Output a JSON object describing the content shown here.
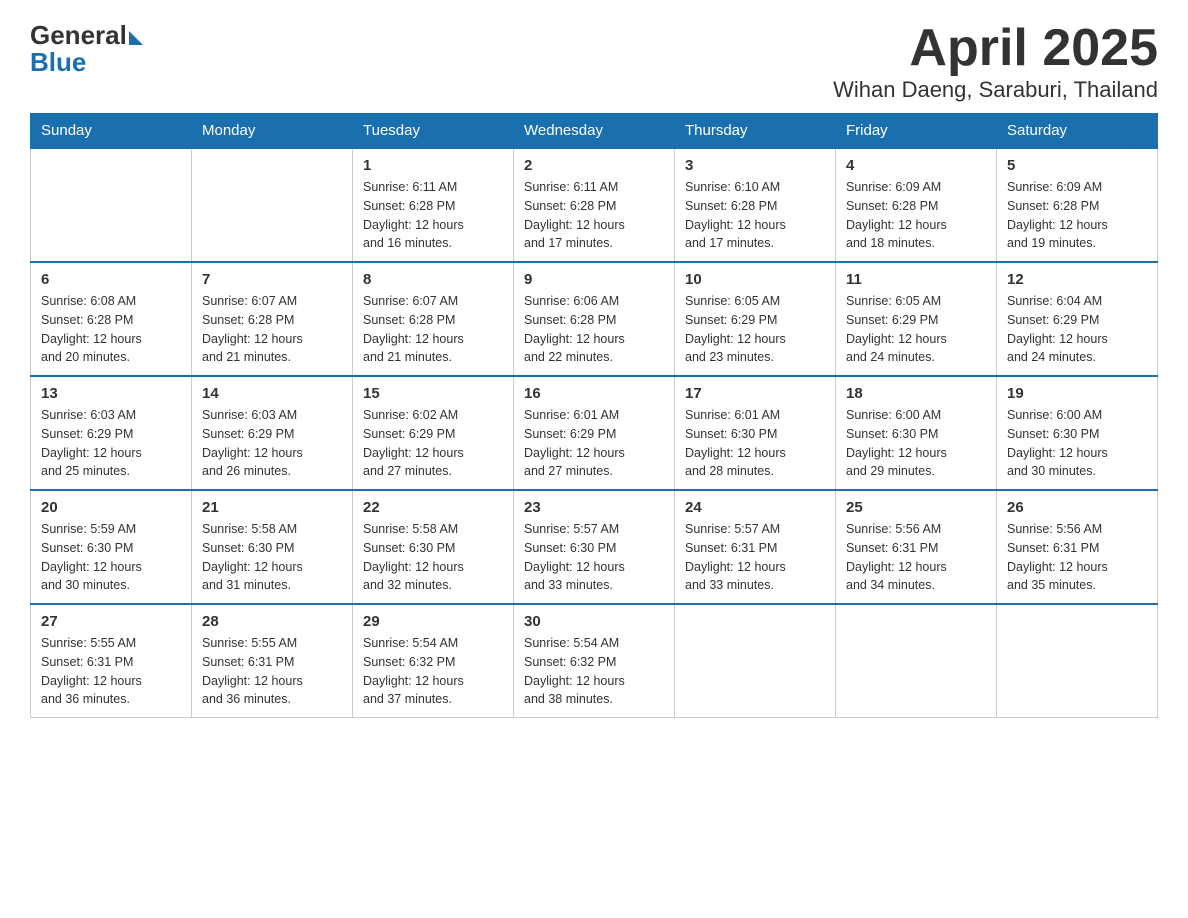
{
  "header": {
    "logo": {
      "general": "General",
      "blue": "Blue"
    },
    "title": "April 2025",
    "subtitle": "Wihan Daeng, Saraburi, Thailand"
  },
  "calendar": {
    "days_of_week": [
      "Sunday",
      "Monday",
      "Tuesday",
      "Wednesday",
      "Thursday",
      "Friday",
      "Saturday"
    ],
    "weeks": [
      [
        {
          "day": "",
          "info": ""
        },
        {
          "day": "",
          "info": ""
        },
        {
          "day": "1",
          "info": "Sunrise: 6:11 AM\nSunset: 6:28 PM\nDaylight: 12 hours\nand 16 minutes."
        },
        {
          "day": "2",
          "info": "Sunrise: 6:11 AM\nSunset: 6:28 PM\nDaylight: 12 hours\nand 17 minutes."
        },
        {
          "day": "3",
          "info": "Sunrise: 6:10 AM\nSunset: 6:28 PM\nDaylight: 12 hours\nand 17 minutes."
        },
        {
          "day": "4",
          "info": "Sunrise: 6:09 AM\nSunset: 6:28 PM\nDaylight: 12 hours\nand 18 minutes."
        },
        {
          "day": "5",
          "info": "Sunrise: 6:09 AM\nSunset: 6:28 PM\nDaylight: 12 hours\nand 19 minutes."
        }
      ],
      [
        {
          "day": "6",
          "info": "Sunrise: 6:08 AM\nSunset: 6:28 PM\nDaylight: 12 hours\nand 20 minutes."
        },
        {
          "day": "7",
          "info": "Sunrise: 6:07 AM\nSunset: 6:28 PM\nDaylight: 12 hours\nand 21 minutes."
        },
        {
          "day": "8",
          "info": "Sunrise: 6:07 AM\nSunset: 6:28 PM\nDaylight: 12 hours\nand 21 minutes."
        },
        {
          "day": "9",
          "info": "Sunrise: 6:06 AM\nSunset: 6:28 PM\nDaylight: 12 hours\nand 22 minutes."
        },
        {
          "day": "10",
          "info": "Sunrise: 6:05 AM\nSunset: 6:29 PM\nDaylight: 12 hours\nand 23 minutes."
        },
        {
          "day": "11",
          "info": "Sunrise: 6:05 AM\nSunset: 6:29 PM\nDaylight: 12 hours\nand 24 minutes."
        },
        {
          "day": "12",
          "info": "Sunrise: 6:04 AM\nSunset: 6:29 PM\nDaylight: 12 hours\nand 24 minutes."
        }
      ],
      [
        {
          "day": "13",
          "info": "Sunrise: 6:03 AM\nSunset: 6:29 PM\nDaylight: 12 hours\nand 25 minutes."
        },
        {
          "day": "14",
          "info": "Sunrise: 6:03 AM\nSunset: 6:29 PM\nDaylight: 12 hours\nand 26 minutes."
        },
        {
          "day": "15",
          "info": "Sunrise: 6:02 AM\nSunset: 6:29 PM\nDaylight: 12 hours\nand 27 minutes."
        },
        {
          "day": "16",
          "info": "Sunrise: 6:01 AM\nSunset: 6:29 PM\nDaylight: 12 hours\nand 27 minutes."
        },
        {
          "day": "17",
          "info": "Sunrise: 6:01 AM\nSunset: 6:30 PM\nDaylight: 12 hours\nand 28 minutes."
        },
        {
          "day": "18",
          "info": "Sunrise: 6:00 AM\nSunset: 6:30 PM\nDaylight: 12 hours\nand 29 minutes."
        },
        {
          "day": "19",
          "info": "Sunrise: 6:00 AM\nSunset: 6:30 PM\nDaylight: 12 hours\nand 30 minutes."
        }
      ],
      [
        {
          "day": "20",
          "info": "Sunrise: 5:59 AM\nSunset: 6:30 PM\nDaylight: 12 hours\nand 30 minutes."
        },
        {
          "day": "21",
          "info": "Sunrise: 5:58 AM\nSunset: 6:30 PM\nDaylight: 12 hours\nand 31 minutes."
        },
        {
          "day": "22",
          "info": "Sunrise: 5:58 AM\nSunset: 6:30 PM\nDaylight: 12 hours\nand 32 minutes."
        },
        {
          "day": "23",
          "info": "Sunrise: 5:57 AM\nSunset: 6:30 PM\nDaylight: 12 hours\nand 33 minutes."
        },
        {
          "day": "24",
          "info": "Sunrise: 5:57 AM\nSunset: 6:31 PM\nDaylight: 12 hours\nand 33 minutes."
        },
        {
          "day": "25",
          "info": "Sunrise: 5:56 AM\nSunset: 6:31 PM\nDaylight: 12 hours\nand 34 minutes."
        },
        {
          "day": "26",
          "info": "Sunrise: 5:56 AM\nSunset: 6:31 PM\nDaylight: 12 hours\nand 35 minutes."
        }
      ],
      [
        {
          "day": "27",
          "info": "Sunrise: 5:55 AM\nSunset: 6:31 PM\nDaylight: 12 hours\nand 36 minutes."
        },
        {
          "day": "28",
          "info": "Sunrise: 5:55 AM\nSunset: 6:31 PM\nDaylight: 12 hours\nand 36 minutes."
        },
        {
          "day": "29",
          "info": "Sunrise: 5:54 AM\nSunset: 6:32 PM\nDaylight: 12 hours\nand 37 minutes."
        },
        {
          "day": "30",
          "info": "Sunrise: 5:54 AM\nSunset: 6:32 PM\nDaylight: 12 hours\nand 38 minutes."
        },
        {
          "day": "",
          "info": ""
        },
        {
          "day": "",
          "info": ""
        },
        {
          "day": "",
          "info": ""
        }
      ]
    ]
  }
}
